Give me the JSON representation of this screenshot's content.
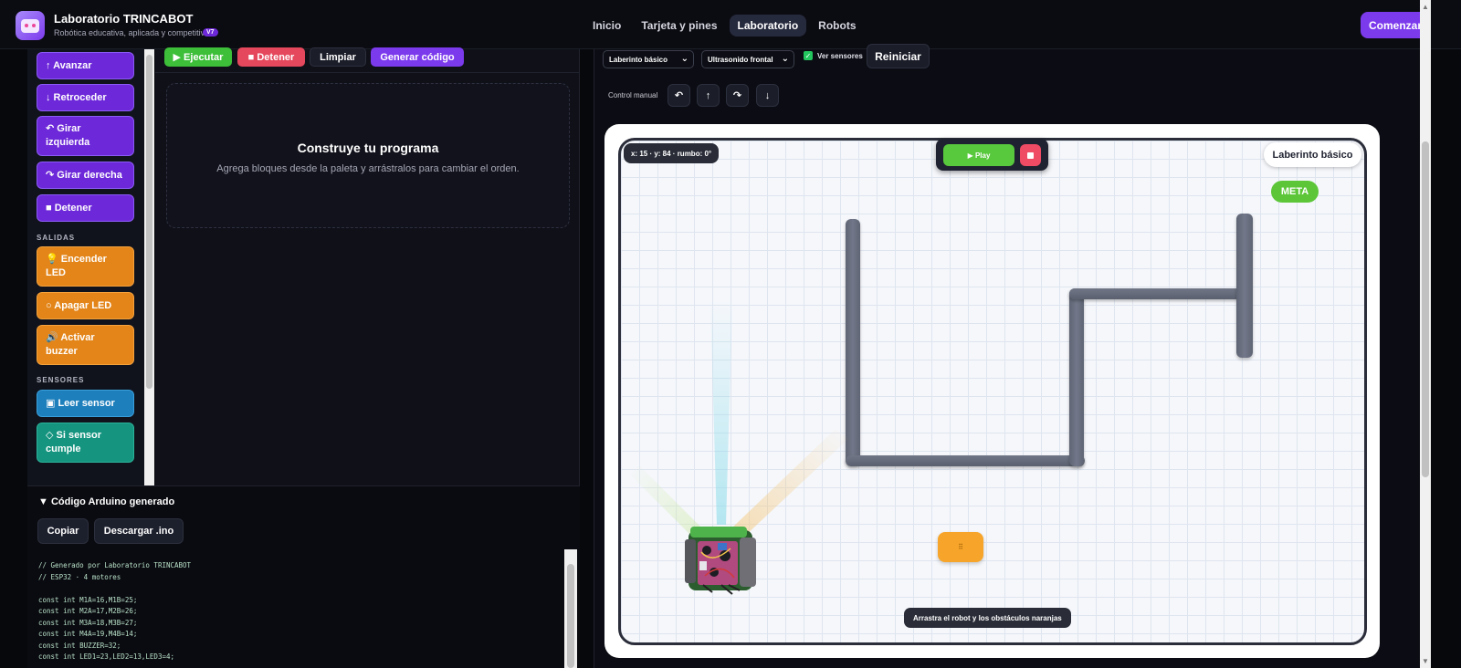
{
  "header": {
    "brand_title": "Laboratorio TRINCABOT",
    "brand_subtitle": "Robótica educativa, aplicada y competitiva",
    "version_badge": "V7",
    "nav": [
      "Inicio",
      "Tarjeta y pines",
      "Laboratorio",
      "Robots"
    ],
    "nav_active": "Laboratorio",
    "start_button": "Comenzar"
  },
  "palette": {
    "motion_blocks": [
      "↑ Avanzar",
      "↓ Retroceder",
      "↶ Girar izquierda",
      "↷ Girar derecha",
      "■ Detener"
    ],
    "outputs_section": "SALIDAS",
    "output_blocks": [
      "💡 Encender LED",
      "○ Apagar LED",
      "🔊 Activar buzzer"
    ],
    "sensors_section": "SENSORES",
    "sensor_blocks": [
      "▣ Leer sensor",
      "◇ Si sensor cumple"
    ]
  },
  "program": {
    "toolbar": {
      "run": "▶ Ejecutar",
      "stop": "■ Detener",
      "clear": "Limpiar",
      "generate": "Generar código"
    },
    "empty_title": "Construye tu programa",
    "empty_subtitle": "Agrega bloques desde la paleta y arrástralos para cambiar el orden."
  },
  "code_panel": {
    "title": "▼ Código Arduino generado",
    "copy_button": "Copiar",
    "download_button": "Descargar .ino",
    "code": "// Generado por Laboratorio TRINCABOT\n// ESP32 · 4 motores\n\nconst int M1A=16,M1B=25;\nconst int M2A=17,M2B=26;\nconst int M3A=18,M3B=27;\nconst int M4A=19,M4B=14;\nconst int BUZZER=32;\nconst int LED1=23,LED2=13,LED3=4;"
  },
  "simulator": {
    "scenario_select": "Laberinto básico",
    "sensor_select": "Ultrasonido frontal",
    "show_sensors_label": "Ver sensores",
    "show_sensors_checked": true,
    "reset_button": "Reiniciar",
    "manual_label": "Control manual",
    "manual_buttons": [
      "↶",
      "↑",
      "↷",
      "↓"
    ],
    "coords": "x: 15 · y: 84 · rumbo: 0°",
    "play_button": "▶ Play",
    "maze_name": "Laberinto básico",
    "goal_label": "META",
    "obstacle_glyph": "⠿",
    "drag_hint": "Arrastra el robot y los obstáculos naranjas"
  },
  "colors": {
    "accent": "#7c3aed",
    "motion_block": "#6d28d9",
    "output_block": "#e38519",
    "sensor_block": "#1d7fbc",
    "condition_block": "#15947f",
    "play": "#58c83d",
    "stop": "#ef4b65",
    "goal": "#5cc638",
    "obstacle": "#f7a52a"
  }
}
